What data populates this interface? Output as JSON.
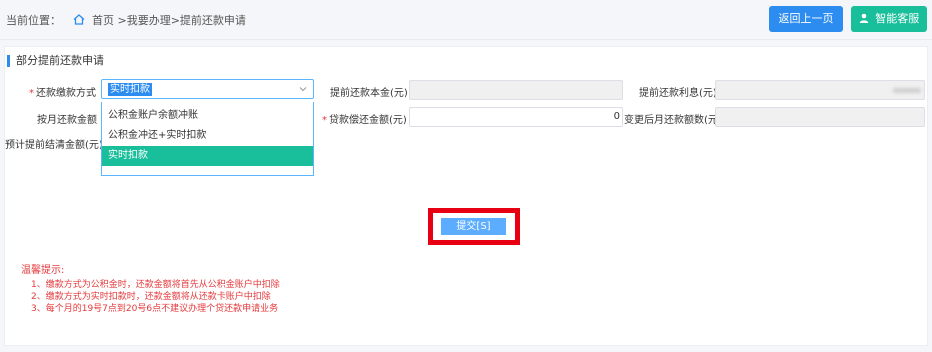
{
  "breadcrumb": {
    "prefix": "当前位置：",
    "home": "首页",
    "trail": ">我要办理>提前还款申请"
  },
  "header": {
    "back_label": "返回上一页",
    "help_label": "智能客服"
  },
  "form": {
    "section_title": "部分提前还款申请",
    "repay_method": {
      "label": "还款缴款方式",
      "value": "实时扣款",
      "options": [
        "公积金账户余额冲账",
        "公积金冲还+实时扣款",
        "实时扣款"
      ]
    },
    "principal_label": "提前还款本金(元)",
    "interest_label": "提前还款利息(元)",
    "monthly_label": "按月还款金额",
    "loan_repay_label": "贷款偿还金额(元)",
    "loan_repay_value": "0",
    "new_monthly_label": "变更后月还款额数(元)",
    "settle_label": "预计提前结清金额(元)"
  },
  "actions": {
    "submit_label": "提交[S]"
  },
  "tips": {
    "title": "温馨提示:",
    "items": [
      "1、缴款方式为公积金时，还款金额将首先从公积金账户中扣除",
      "2、缴款方式为实时扣款时，还款金额将从还款卡账户中扣除",
      "3、每个月的19号7点到20号6点不建议办理个贷还款申请业务"
    ]
  },
  "colors": {
    "primary": "#2d8cf0",
    "success": "#19be9b",
    "danger": "#e4393c",
    "highlight_frame": "#e60012"
  }
}
